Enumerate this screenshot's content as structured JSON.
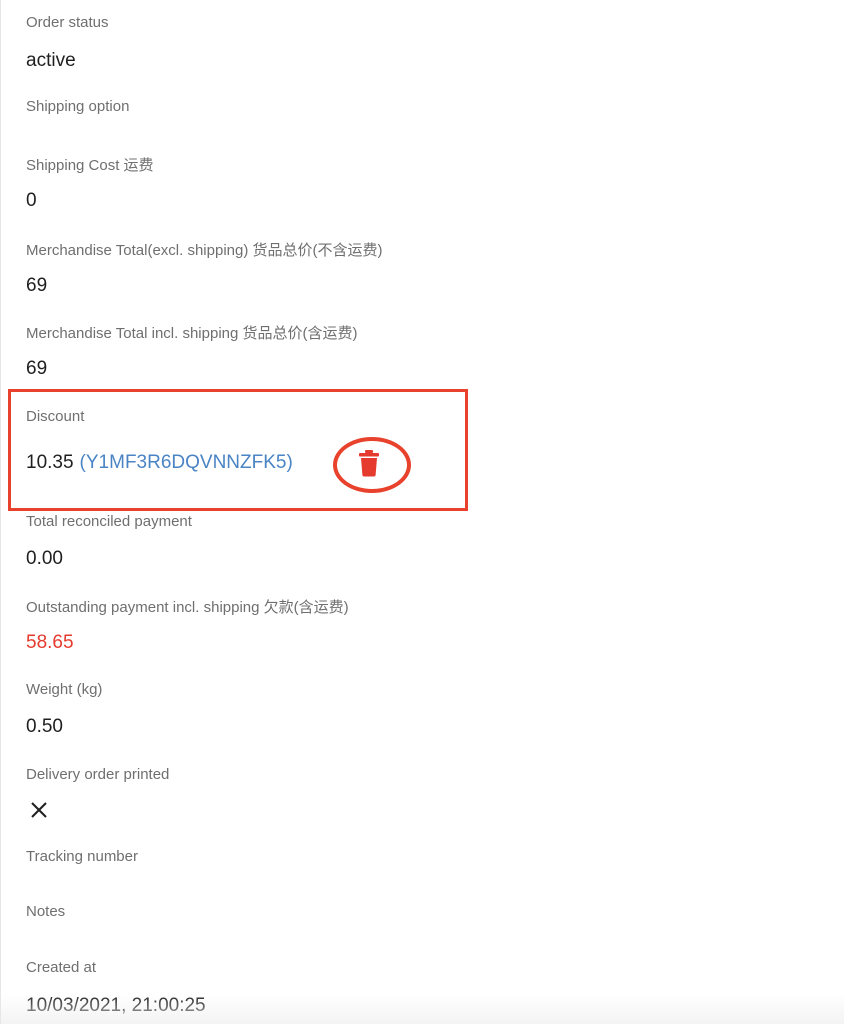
{
  "fields": {
    "order_status": {
      "label": "Order status",
      "value": "active"
    },
    "shipping_option": {
      "label": "Shipping option",
      "value": ""
    },
    "shipping_cost": {
      "label": "Shipping Cost 运费",
      "value": "0"
    },
    "merch_total_excl": {
      "label": "Merchandise Total(excl. shipping) 货品总价(不含运费)",
      "value": "69"
    },
    "merch_total_incl": {
      "label": "Merchandise Total incl. shipping 货品总价(含运费)",
      "value": "69"
    },
    "discount": {
      "label": "Discount",
      "amount": "10.35",
      "code": "(Y1MF3R6DQVNNZFK5)",
      "delete_icon": "trash-icon"
    },
    "total_reconciled": {
      "label": "Total reconciled payment",
      "value": "0.00"
    },
    "outstanding": {
      "label": "Outstanding payment incl. shipping 欠款(含运费)",
      "value": "58.65"
    },
    "weight": {
      "label": "Weight (kg)",
      "value": "0.50"
    },
    "delivery_printed": {
      "label": "Delivery order printed",
      "value_icon": "cross-icon"
    },
    "tracking_number": {
      "label": "Tracking number",
      "value": ""
    },
    "notes": {
      "label": "Notes",
      "value": ""
    },
    "created_at": {
      "label": "Created at",
      "value": "10/03/2021, 21:00:25"
    }
  },
  "colors": {
    "label": "#6f6f6f",
    "value": "#1f1f1f",
    "link": "#4a84c4",
    "danger": "#e53b2f",
    "annotation": "#e8412c"
  }
}
